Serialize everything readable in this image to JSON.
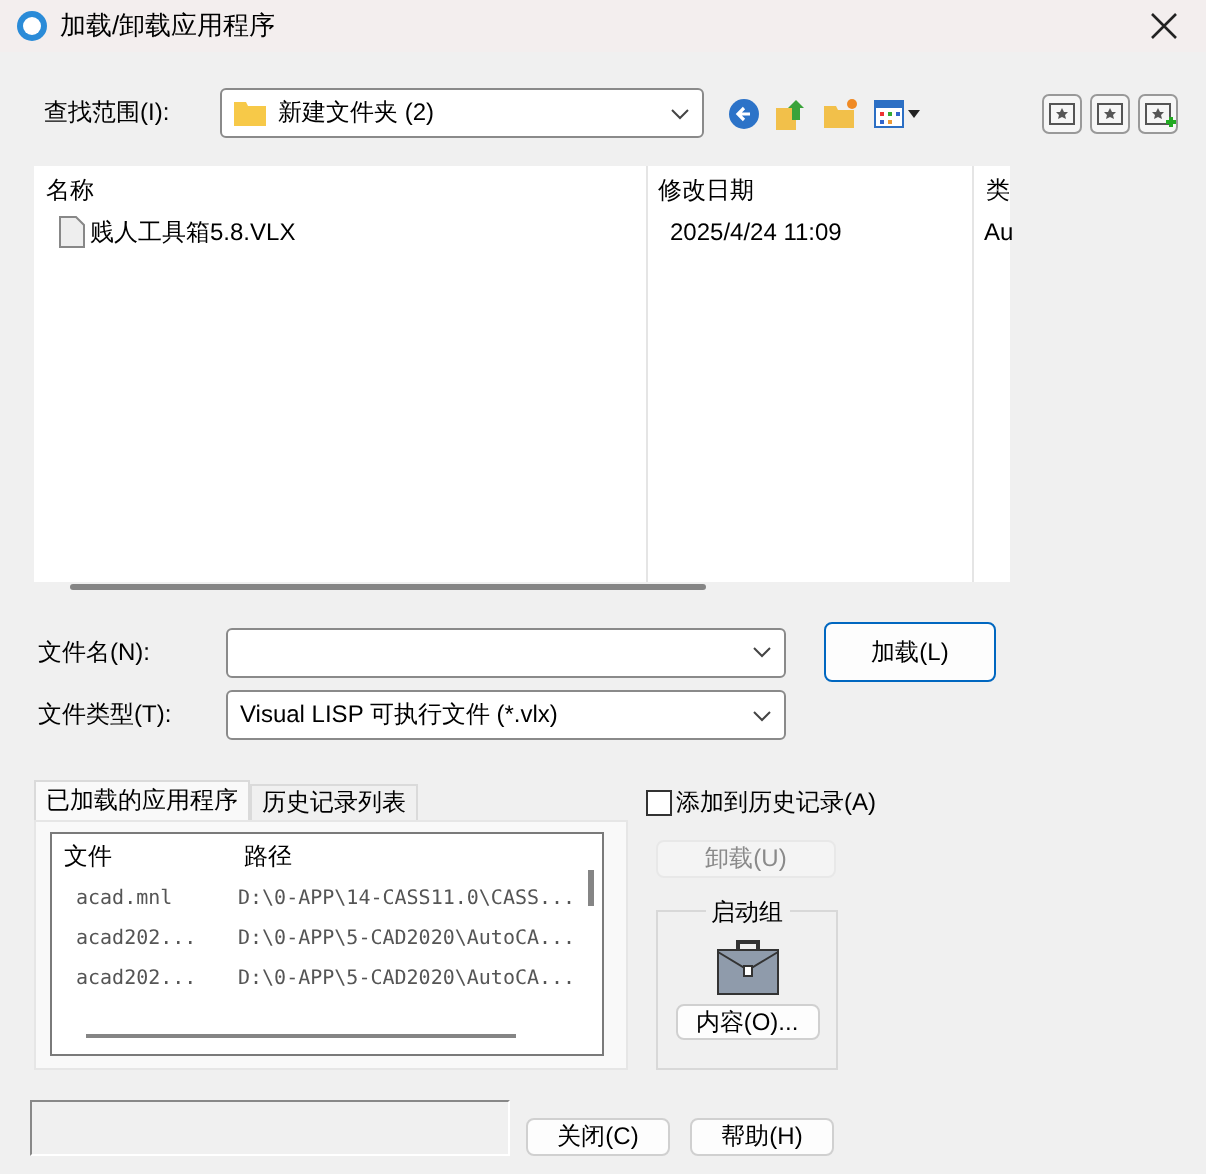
{
  "window": {
    "title": "加载/卸载应用程序"
  },
  "look_in": {
    "label": "查找范围(I):",
    "value": "新建文件夹 (2)"
  },
  "file_list": {
    "columns": [
      "名称",
      "修改日期",
      "类"
    ],
    "rows": [
      {
        "name": "贱人工具箱5.8.VLX",
        "modified": "2025/4/24 11:09",
        "type": "Au"
      }
    ]
  },
  "file_name": {
    "label": "文件名(N):"
  },
  "load_button": "加载(L)",
  "file_type": {
    "label": "文件类型(T):",
    "value": "Visual LISP 可执行文件 (*.vlx)"
  },
  "tabs": [
    {
      "label": "已加载的应用程序",
      "selected": true
    },
    {
      "label": "历史记录列表",
      "selected": false
    }
  ],
  "loaded_apps": {
    "columns": [
      "文件",
      "路径"
    ],
    "rows": [
      {
        "file": "acad.mnl",
        "path": "D:\\0-APP\\14-CASS11.0\\CASS..."
      },
      {
        "file": "acad202...",
        "path": "D:\\0-APP\\5-CAD2020\\AutoCA..."
      },
      {
        "file": "acad202...",
        "path": "D:\\0-APP\\5-CAD2020\\AutoCA..."
      }
    ]
  },
  "add_to_history": {
    "label": "添加到历史记录(A)",
    "checked": false
  },
  "unload_button": {
    "label": "卸载(U)",
    "disabled": true
  },
  "startup_suite": {
    "title": "启动组",
    "button": "内容(O)..."
  },
  "buttons": [
    "关闭(C)",
    "帮助(H)"
  ]
}
